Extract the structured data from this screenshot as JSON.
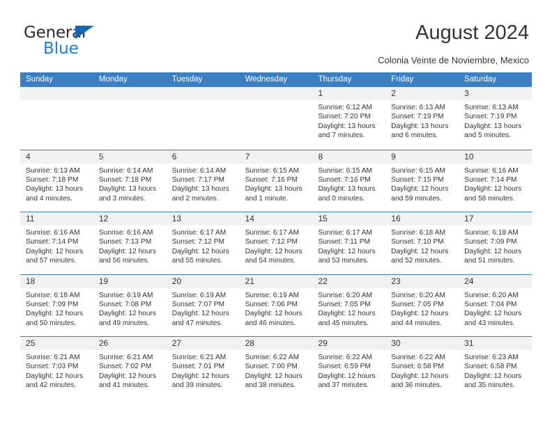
{
  "brand": {
    "line1": "General",
    "line2": "Blue",
    "triangle_color": "#1565b0",
    "blue_text_color": "#1b7fd4"
  },
  "header": {
    "title": "August 2024",
    "subtitle": "Colonia Veinte de Noviembre, Mexico"
  },
  "colors": {
    "header_band": "#3a7fc1",
    "daynum_band": "#f1f1f1",
    "row_divider": "#3a7fc1",
    "text": "#333333"
  },
  "weekdays": [
    "Sunday",
    "Monday",
    "Tuesday",
    "Wednesday",
    "Thursday",
    "Friday",
    "Saturday"
  ],
  "weeks": [
    [
      {
        "day": "",
        "empty": true
      },
      {
        "day": "",
        "empty": true
      },
      {
        "day": "",
        "empty": true
      },
      {
        "day": "",
        "empty": true
      },
      {
        "day": "1",
        "sunrise": "Sunrise: 6:12 AM",
        "sunset": "Sunset: 7:20 PM",
        "daylight": "Daylight: 13 hours and 7 minutes."
      },
      {
        "day": "2",
        "sunrise": "Sunrise: 6:13 AM",
        "sunset": "Sunset: 7:19 PM",
        "daylight": "Daylight: 13 hours and 6 minutes."
      },
      {
        "day": "3",
        "sunrise": "Sunrise: 6:13 AM",
        "sunset": "Sunset: 7:19 PM",
        "daylight": "Daylight: 13 hours and 5 minutes."
      }
    ],
    [
      {
        "day": "4",
        "sunrise": "Sunrise: 6:13 AM",
        "sunset": "Sunset: 7:18 PM",
        "daylight": "Daylight: 13 hours and 4 minutes."
      },
      {
        "day": "5",
        "sunrise": "Sunrise: 6:14 AM",
        "sunset": "Sunset: 7:18 PM",
        "daylight": "Daylight: 13 hours and 3 minutes."
      },
      {
        "day": "6",
        "sunrise": "Sunrise: 6:14 AM",
        "sunset": "Sunset: 7:17 PM",
        "daylight": "Daylight: 13 hours and 2 minutes."
      },
      {
        "day": "7",
        "sunrise": "Sunrise: 6:15 AM",
        "sunset": "Sunset: 7:16 PM",
        "daylight": "Daylight: 13 hours and 1 minute."
      },
      {
        "day": "8",
        "sunrise": "Sunrise: 6:15 AM",
        "sunset": "Sunset: 7:16 PM",
        "daylight": "Daylight: 13 hours and 0 minutes."
      },
      {
        "day": "9",
        "sunrise": "Sunrise: 6:15 AM",
        "sunset": "Sunset: 7:15 PM",
        "daylight": "Daylight: 12 hours and 59 minutes."
      },
      {
        "day": "10",
        "sunrise": "Sunrise: 6:16 AM",
        "sunset": "Sunset: 7:14 PM",
        "daylight": "Daylight: 12 hours and 58 minutes."
      }
    ],
    [
      {
        "day": "11",
        "sunrise": "Sunrise: 6:16 AM",
        "sunset": "Sunset: 7:14 PM",
        "daylight": "Daylight: 12 hours and 57 minutes."
      },
      {
        "day": "12",
        "sunrise": "Sunrise: 6:16 AM",
        "sunset": "Sunset: 7:13 PM",
        "daylight": "Daylight: 12 hours and 56 minutes."
      },
      {
        "day": "13",
        "sunrise": "Sunrise: 6:17 AM",
        "sunset": "Sunset: 7:12 PM",
        "daylight": "Daylight: 12 hours and 55 minutes."
      },
      {
        "day": "14",
        "sunrise": "Sunrise: 6:17 AM",
        "sunset": "Sunset: 7:12 PM",
        "daylight": "Daylight: 12 hours and 54 minutes."
      },
      {
        "day": "15",
        "sunrise": "Sunrise: 6:17 AM",
        "sunset": "Sunset: 7:11 PM",
        "daylight": "Daylight: 12 hours and 53 minutes."
      },
      {
        "day": "16",
        "sunrise": "Sunrise: 6:18 AM",
        "sunset": "Sunset: 7:10 PM",
        "daylight": "Daylight: 12 hours and 52 minutes."
      },
      {
        "day": "17",
        "sunrise": "Sunrise: 6:18 AM",
        "sunset": "Sunset: 7:09 PM",
        "daylight": "Daylight: 12 hours and 51 minutes."
      }
    ],
    [
      {
        "day": "18",
        "sunrise": "Sunrise: 6:18 AM",
        "sunset": "Sunset: 7:09 PM",
        "daylight": "Daylight: 12 hours and 50 minutes."
      },
      {
        "day": "19",
        "sunrise": "Sunrise: 6:19 AM",
        "sunset": "Sunset: 7:08 PM",
        "daylight": "Daylight: 12 hours and 49 minutes."
      },
      {
        "day": "20",
        "sunrise": "Sunrise: 6:19 AM",
        "sunset": "Sunset: 7:07 PM",
        "daylight": "Daylight: 12 hours and 47 minutes."
      },
      {
        "day": "21",
        "sunrise": "Sunrise: 6:19 AM",
        "sunset": "Sunset: 7:06 PM",
        "daylight": "Daylight: 12 hours and 46 minutes."
      },
      {
        "day": "22",
        "sunrise": "Sunrise: 6:20 AM",
        "sunset": "Sunset: 7:05 PM",
        "daylight": "Daylight: 12 hours and 45 minutes."
      },
      {
        "day": "23",
        "sunrise": "Sunrise: 6:20 AM",
        "sunset": "Sunset: 7:05 PM",
        "daylight": "Daylight: 12 hours and 44 minutes."
      },
      {
        "day": "24",
        "sunrise": "Sunrise: 6:20 AM",
        "sunset": "Sunset: 7:04 PM",
        "daylight": "Daylight: 12 hours and 43 minutes."
      }
    ],
    [
      {
        "day": "25",
        "sunrise": "Sunrise: 6:21 AM",
        "sunset": "Sunset: 7:03 PM",
        "daylight": "Daylight: 12 hours and 42 minutes."
      },
      {
        "day": "26",
        "sunrise": "Sunrise: 6:21 AM",
        "sunset": "Sunset: 7:02 PM",
        "daylight": "Daylight: 12 hours and 41 minutes."
      },
      {
        "day": "27",
        "sunrise": "Sunrise: 6:21 AM",
        "sunset": "Sunset: 7:01 PM",
        "daylight": "Daylight: 12 hours and 39 minutes."
      },
      {
        "day": "28",
        "sunrise": "Sunrise: 6:22 AM",
        "sunset": "Sunset: 7:00 PM",
        "daylight": "Daylight: 12 hours and 38 minutes."
      },
      {
        "day": "29",
        "sunrise": "Sunrise: 6:22 AM",
        "sunset": "Sunset: 6:59 PM",
        "daylight": "Daylight: 12 hours and 37 minutes."
      },
      {
        "day": "30",
        "sunrise": "Sunrise: 6:22 AM",
        "sunset": "Sunset: 6:58 PM",
        "daylight": "Daylight: 12 hours and 36 minutes."
      },
      {
        "day": "31",
        "sunrise": "Sunrise: 6:23 AM",
        "sunset": "Sunset: 6:58 PM",
        "daylight": "Daylight: 12 hours and 35 minutes."
      }
    ]
  ]
}
